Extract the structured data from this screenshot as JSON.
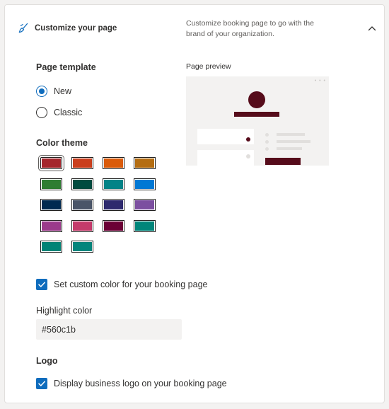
{
  "header": {
    "title": "Customize your page",
    "description": "Customize booking page to go with the brand of your organization."
  },
  "page_template": {
    "label": "Page template",
    "options": [
      {
        "label": "New",
        "checked": true
      },
      {
        "label": "Classic",
        "checked": false
      }
    ]
  },
  "page_preview": {
    "label": "Page preview",
    "accent": "#560c1b"
  },
  "color_theme": {
    "label": "Color theme",
    "selected_index": 0,
    "swatches": [
      "#a4262c",
      "#ca3f1e",
      "#da5b0a",
      "#b46d12",
      "#2e7d32",
      "#004b3f",
      "#038387",
      "#0078d4",
      "#002a50",
      "#4a5568",
      "#2e2a6e",
      "#7c4fa0",
      "#9b3a8b",
      "#c43b6b",
      "#6b0035",
      "#00857a",
      "#028376",
      "#04857c"
    ]
  },
  "custom_color": {
    "label": "Set custom color for your booking page",
    "checked": true
  },
  "highlight_color": {
    "label": "Highlight color",
    "value": "#560c1b"
  },
  "logo": {
    "label": "Logo",
    "checkbox_label": "Display business logo on your booking page",
    "checked": true
  },
  "colors": {
    "accent_blue": "#0f6cbd",
    "card_background": "#ffffff",
    "page_background": "#f3f2f1"
  },
  "icons": {
    "header": "paintbrush-icon",
    "collapse": "chevron-up-icon"
  }
}
